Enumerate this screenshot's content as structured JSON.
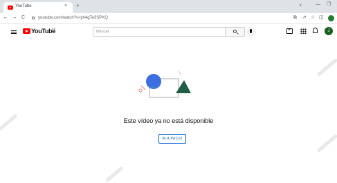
{
  "browser": {
    "tab": {
      "title": "YouTube",
      "close": "×"
    },
    "new_tab": "+",
    "tab_menu": "∨",
    "window_controls": {
      "minimize": "—",
      "restore": "❐"
    },
    "nav": {
      "back": "←",
      "forward": "→",
      "reload": "C"
    },
    "url": "youtube.com/watch?v=yh4gTe3SPXQ",
    "toolbar_icons": [
      "share-icon",
      "password-icon",
      "star-icon",
      "sidebar-icon",
      "profile-icon"
    ],
    "toolbar_glyphs": {
      "share": "⧉",
      "cast": "⇗",
      "bookmark": "☆",
      "sidebar": "◫"
    }
  },
  "youtube": {
    "logo_text": "YouTube",
    "country_code": "ES",
    "search_placeholder": "Buscar",
    "avatar_initial": "J",
    "colors": {
      "brand_red": "#ff0000",
      "link_blue": "#065fd4",
      "avatar_green": "#1b5e20"
    }
  },
  "content": {
    "message": "Este vídeo ya no está disponible",
    "home_button": "IR A INICIO"
  }
}
